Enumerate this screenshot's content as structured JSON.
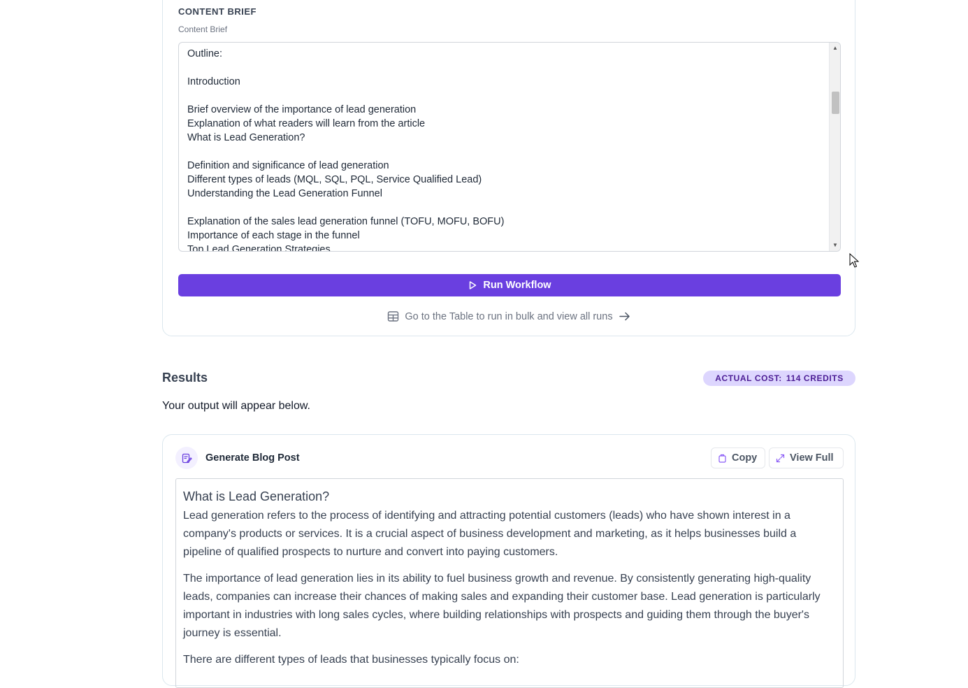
{
  "content_brief": {
    "section_title": "CONTENT BRIEF",
    "field_label": "Content Brief",
    "lines": [
      "Outline:",
      "",
      "Introduction",
      "",
      "Brief overview of the importance of lead generation",
      "Explanation of what readers will learn from the article",
      "What is Lead Generation?",
      "",
      "Definition and significance of lead generation",
      "Different types of leads (MQL, SQL, PQL, Service Qualified Lead)",
      "Understanding the Lead Generation Funnel",
      "",
      "Explanation of the sales lead generation funnel (TOFU, MOFU, BOFU)",
      "Importance of each stage in the funnel",
      "Top Lead Generation Strategies"
    ]
  },
  "actions": {
    "run_label": "Run Workflow",
    "table_link_label": "Go to the Table to run in bulk and view all runs"
  },
  "results": {
    "title": "Results",
    "cost_label": "ACTUAL COST:",
    "cost_value": "114 CREDITS",
    "subtitle": "Your output will appear below."
  },
  "output": {
    "title": "Generate Blog Post",
    "copy_label": "Copy",
    "view_full_label": "View Full",
    "heading": "What is Lead Generation?",
    "paragraphs": [
      "Lead generation refers to the process of identifying and attracting potential customers (leads) who have shown interest in a company's products or services. It is a crucial aspect of business development and marketing, as it helps businesses build a pipeline of qualified prospects to nurture and convert into paying customers.",
      "The importance of lead generation lies in its ability to fuel business growth and revenue. By consistently generating high-quality leads, companies can increase their chances of making sales and expanding their customer base. Lead generation is particularly important in industries with long sales cycles, where building relationships with prospects and guiding them through the buyer's journey is essential.",
      "There are different types of leads that businesses typically focus on:"
    ]
  },
  "colors": {
    "accent": "#6a3fe0",
    "badge_bg": "#ddd6fe",
    "badge_text": "#4c1d95"
  }
}
